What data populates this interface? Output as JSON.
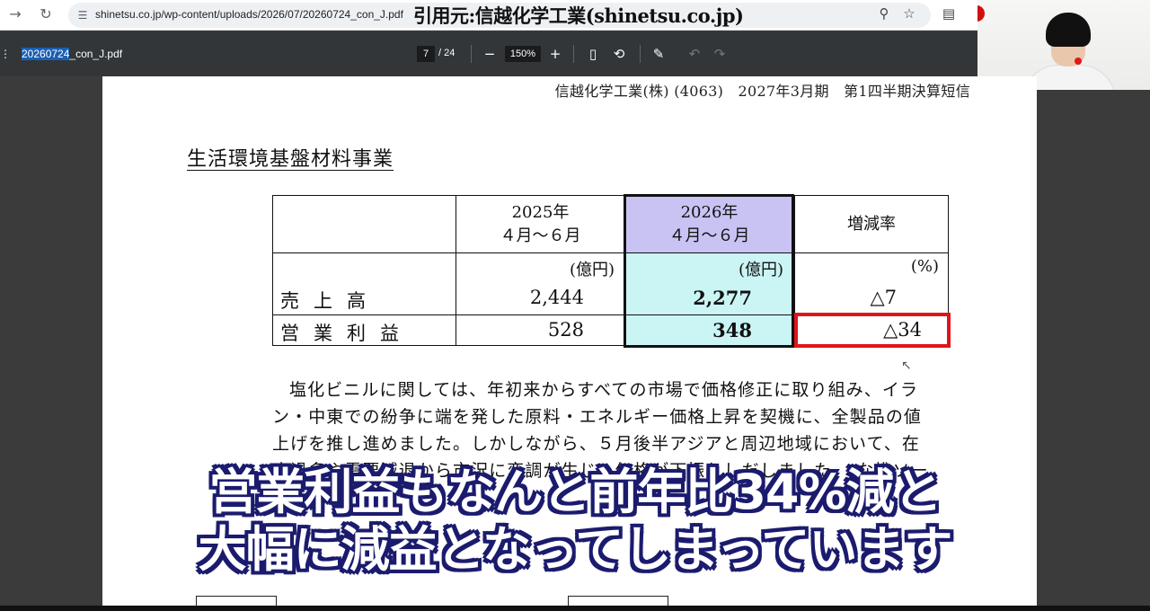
{
  "browser": {
    "url": "shinetsu.co.jp/wp-content/uploads/2026/07/20260724_con_J.pdf",
    "source_overlay": "引用元:信越化学工業(shinetsu.co.jp)"
  },
  "pdf_toolbar": {
    "filename_selected": "20260724",
    "filename_rest": "_con_J.pdf",
    "page_current": "7",
    "page_total": "/ 24",
    "zoom": "150%"
  },
  "document": {
    "header": "信越化学工業(株) (4063)　2027年3月期　第1四半期決算短信",
    "section_title": "生活環境基盤材料事業",
    "table": {
      "col_2025_line1": "2025年",
      "col_2025_line2": "４月～６月",
      "col_2026_line1": "2026年",
      "col_2026_line2": "４月～６月",
      "col_change": "増減率",
      "unit_2025": "(億円)",
      "unit_2026": "(億円)",
      "unit_change": "(%)",
      "rows": [
        {
          "label": "売上高",
          "v2025": "2,444",
          "v2026": "2,277",
          "change": "△7"
        },
        {
          "label": "営業利益",
          "v2025": "528",
          "v2026": "348",
          "change": "△34"
        }
      ]
    },
    "paragraph_lines": [
      "塩化ビニルに関しては、年初来からすべての市場で価格修正に取り組み、イラ",
      "ン・中東での紛争に端を発した原料・エネルギー価格上昇を契機に、全製品の値",
      "上げを推し進めました。しかしながら、５月後半アジアと周辺地域において、在",
      "庫過多や需要減退から市況に変調が生じ、価格が下振れしだしました。 な推ソー"
    ]
  },
  "caption": {
    "line1": "営業利益もなんと前年比34%減と",
    "line2": "大幅に減益となってしまっています"
  },
  "colors": {
    "highlight_header": "#c9c3f3",
    "highlight_column": "#cbf5f5",
    "red_box": "#e0141b",
    "caption_outline": "#1b1b6e"
  }
}
